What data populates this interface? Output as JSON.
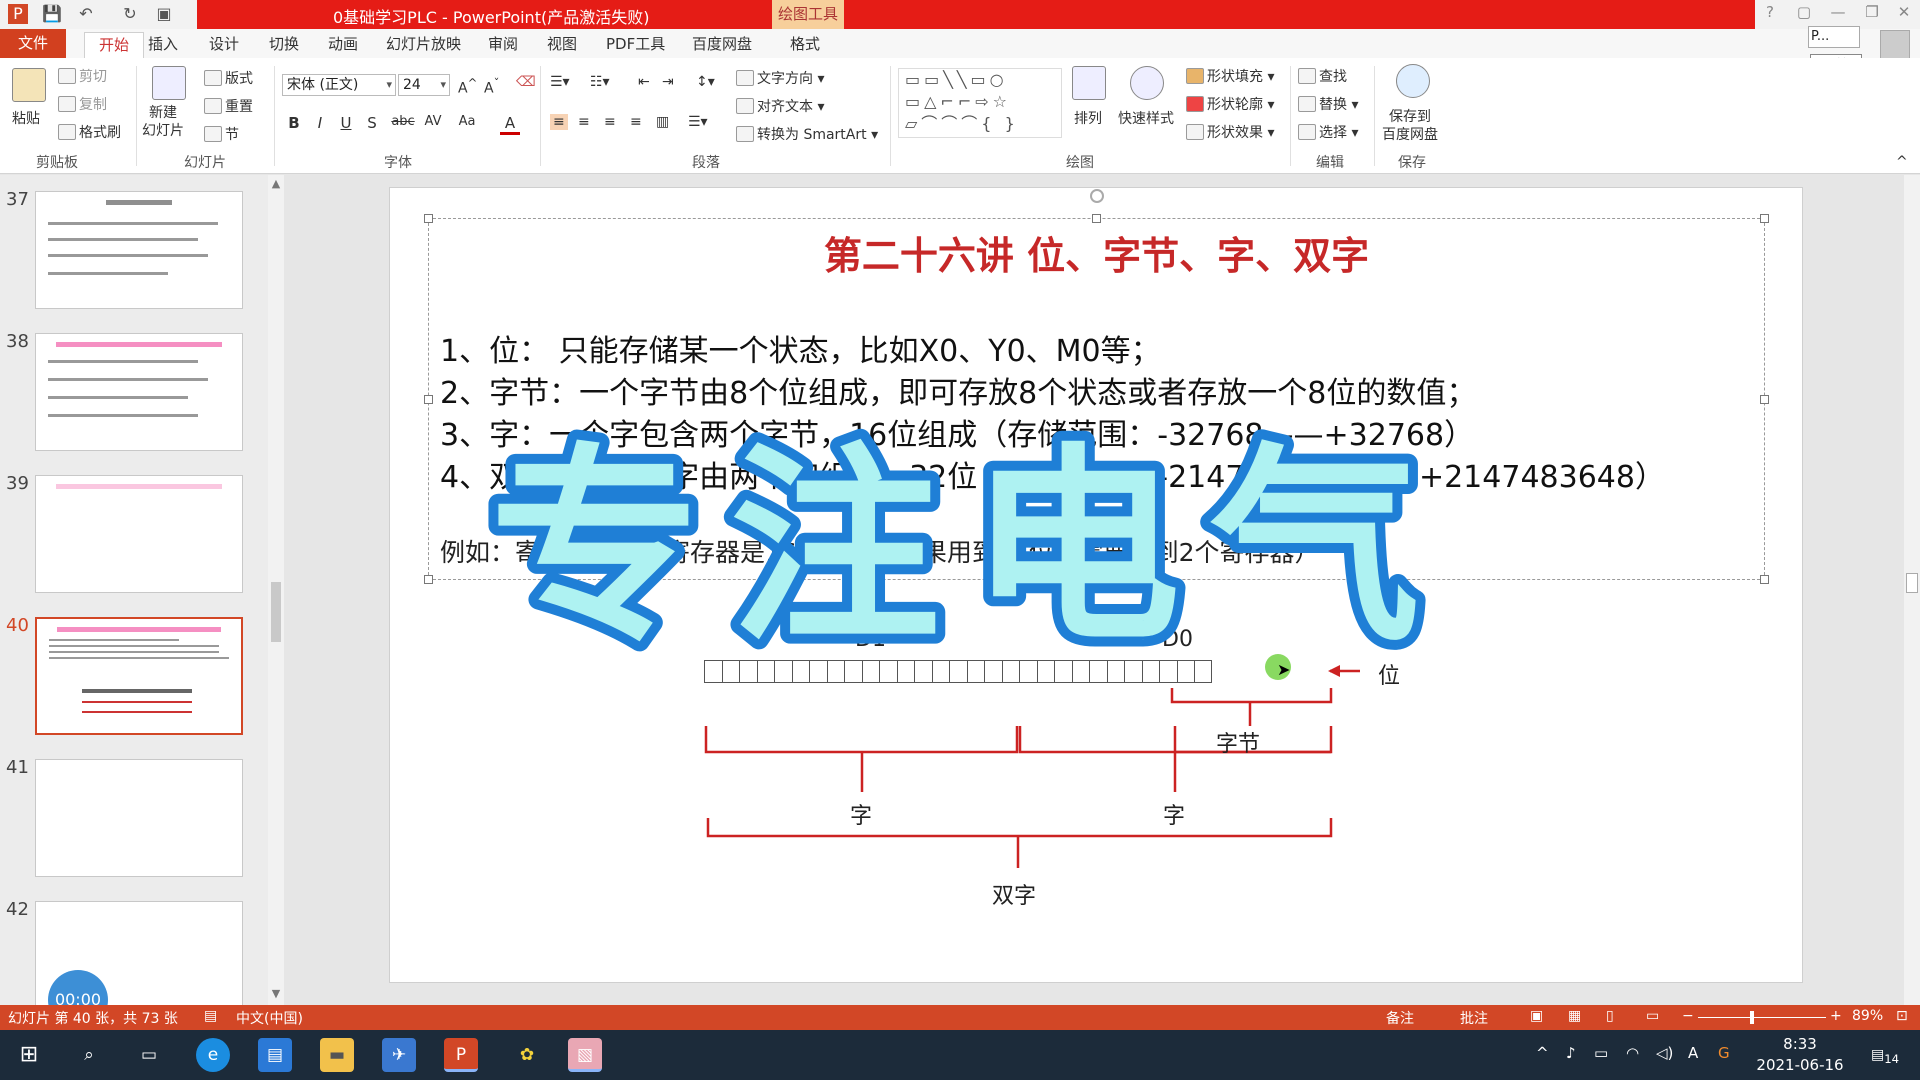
{
  "window": {
    "title": "0基础学习PLC - PowerPoint(产品激活失败)",
    "context_tab": "绘图工具",
    "user_box": "P...",
    "tooltip": "开始",
    "controls": [
      "?",
      "▢",
      "—",
      "❐",
      "✕"
    ]
  },
  "tabs": [
    "文件",
    "开始",
    "插入",
    "设计",
    "切换",
    "动画",
    "幻灯片放映",
    "审阅",
    "视图",
    "PDF工具",
    "百度网盘",
    "格式"
  ],
  "ribbon": {
    "clipboard": {
      "paste": "粘贴",
      "cut": "剪切",
      "copy": "复制",
      "format_painter": "格式刷",
      "label": "剪贴板"
    },
    "slides": {
      "new_slide": "新建\n幻灯片",
      "layout": "版式",
      "reset": "重置",
      "section": "节",
      "label": "幻灯片"
    },
    "font": {
      "name": "宋体 (正文)",
      "size": "24",
      "label": "字体",
      "buttons": [
        "B",
        "I",
        "U",
        "S",
        "abc",
        "AV",
        "Aa",
        "A"
      ]
    },
    "paragraph": {
      "text_direction": "文字方向",
      "align_text": "对齐文本",
      "smartart": "转换为 SmartArt",
      "label": "段落"
    },
    "drawing": {
      "arrange": "排列",
      "quick_styles": "快速样式",
      "shape_fill": "形状填充",
      "shape_outline": "形状轮廓",
      "shape_effects": "形状效果",
      "label": "绘图"
    },
    "editing": {
      "find": "查找",
      "replace": "替换",
      "select": "选择",
      "label": "编辑"
    },
    "save": {
      "save_to_baidu": "保存到\n百度网盘",
      "label": "保存"
    }
  },
  "thumbnails": [
    {
      "num": "37",
      "active": false
    },
    {
      "num": "38",
      "active": false
    },
    {
      "num": "39",
      "active": false
    },
    {
      "num": "40",
      "active": true
    },
    {
      "num": "41",
      "active": false
    },
    {
      "num": "42",
      "active": false
    }
  ],
  "timer": "00:00",
  "slide": {
    "title": "第二十六讲  位、字节、字、双字",
    "lines": [
      "1、位：    只能存储某一个状态，比如X0、Y0、M0等；",
      "2、字节：一个字节由8个位组成，即可存放8个状态或者存放一个8位的数值；",
      "3、字：一个字包含两个字节，16位组成（存储范围：-32768——+32768）",
      "4、双字：一个双字由两个字组成，32位（存储范围：-2147483648——+2147483648）"
    ],
    "example": "例如：寄存器（每个寄存器是16位组成，如果用到32位就需要用到2个寄存器）",
    "diagram": {
      "label_d1": "D1",
      "label_d0": "D0",
      "label_bit": "位",
      "label_byte": "字节",
      "label_word_left": "字",
      "label_word_right": "字",
      "label_dword": "双字",
      "bit_count": 29
    },
    "watermark": "专注电气"
  },
  "status": {
    "slide_info": "幻灯片 第 40 张，共 73 张",
    "language": "中文(中国)",
    "notes": "备注",
    "comments": "批注",
    "zoom": "89%"
  },
  "taskbar": {
    "time": "8:33",
    "date": "2021-06-16",
    "ime": "A",
    "notification_count": "14"
  },
  "colors": {
    "accent": "#d24726",
    "title_red": "#c62828",
    "bracket_red": "#cc2222",
    "watermark_fill": "#aef2f2",
    "watermark_stroke": "#1f7fd6"
  }
}
